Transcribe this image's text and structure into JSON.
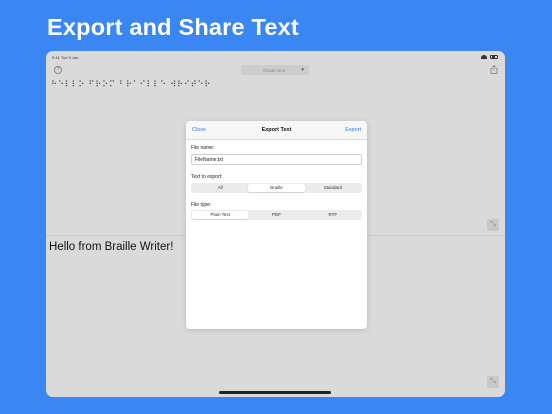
{
  "headline": "Export and Share Text",
  "status_bar": {
    "time": "9:41 Tue 9 Jan"
  },
  "toolbar": {
    "grade_label": "Grade One",
    "grade_chevron": "▼"
  },
  "document": {
    "braille_text": "⠓⠑⠇⠇⠕ ⠋⠗⠕⠍ ⠃⠗⠁⠊⠇⠇⠑ ⠺⠗⠊⠞⠑⠗",
    "print_text": "Hello from Braille Writer!"
  },
  "export_dialog": {
    "close_label": "Close",
    "title": "Export Text",
    "export_label": "Export",
    "file_name_label": "File name:",
    "file_name_value": "FileName.txt",
    "text_to_export_label": "Text to export:",
    "text_options": [
      "All",
      "Braille",
      "Standard"
    ],
    "text_selected": "Braille",
    "file_type_label": "File type:",
    "file_type_options": [
      "Plain Text",
      "PDF",
      "RTF"
    ],
    "file_type_selected": "Plain Text"
  },
  "icons": {
    "help": "help-icon",
    "share": "share-icon",
    "expand": "expand-icon",
    "wifi": "wifi-icon",
    "battery": "battery-icon"
  },
  "colors": {
    "background": "#3a86f3",
    "accent": "#2f7cf6"
  }
}
